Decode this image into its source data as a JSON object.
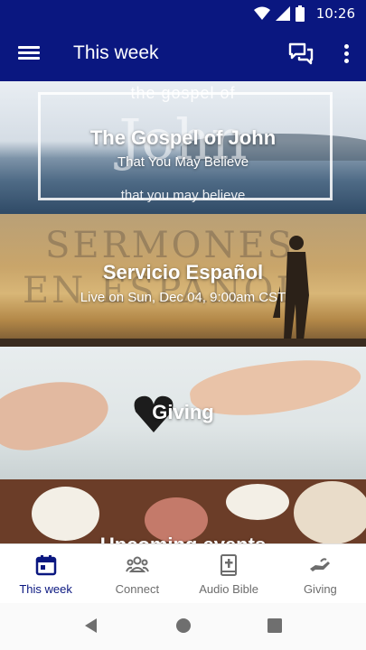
{
  "status_bar": {
    "time": "10:26"
  },
  "app_bar": {
    "title": "This week"
  },
  "cards": [
    {
      "title": "The Gospel of John",
      "subtitle": "That You May Believe",
      "image_top_text": "the gospel of",
      "image_big_text": "John",
      "image_bottom_text": "that you may believe"
    },
    {
      "title": "Servicio Español",
      "subtitle": "Live on Sun, Dec 04, 9:00am CST",
      "image_line1": "SERMONES",
      "image_line2": "EN ESPAÑOL"
    },
    {
      "title": "Giving"
    },
    {
      "title": "Upcoming events"
    }
  ],
  "bottom_nav": [
    {
      "label": "This week",
      "icon": "calendar-icon",
      "active": true
    },
    {
      "label": "Connect",
      "icon": "people-icon"
    },
    {
      "label": "Audio Bible",
      "icon": "bible-icon"
    },
    {
      "label": "Giving",
      "icon": "giving-hand-icon"
    }
  ],
  "colors": {
    "brand": "#0a1780",
    "nav_inactive": "#6d6d6d"
  }
}
